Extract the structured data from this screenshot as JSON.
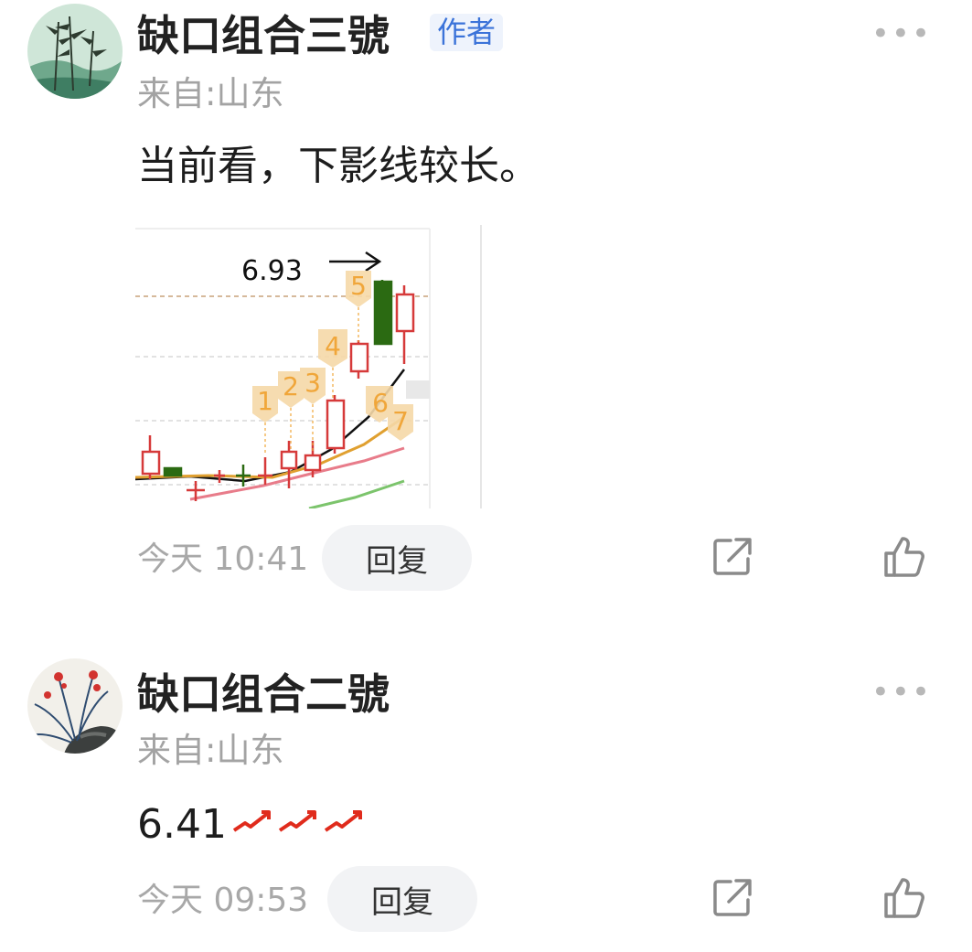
{
  "comments": [
    {
      "username": "缺口组合三號",
      "badge": "作者",
      "location": "来自:山东",
      "text": "当前看，下影线较长。",
      "time": "今天 10:41",
      "reply_label": "回复",
      "image": {
        "price_label": "6.93",
        "markers": [
          "1",
          "2",
          "3",
          "4",
          "5",
          "6",
          "7"
        ]
      }
    },
    {
      "username": "缺口组合二號",
      "location": "来自:山东",
      "text": "6.41",
      "time": "今天 09:53",
      "reply_label": "回复"
    }
  ],
  "icons": {
    "more": "more-icon",
    "share": "share-icon",
    "like": "like-icon"
  },
  "colors": {
    "badge_text": "#3b73d9",
    "badge_bg": "#eef3fc",
    "up_candle": "#d63a3a",
    "down_candle": "#2b6a12",
    "marker": "#f0a63a"
  }
}
